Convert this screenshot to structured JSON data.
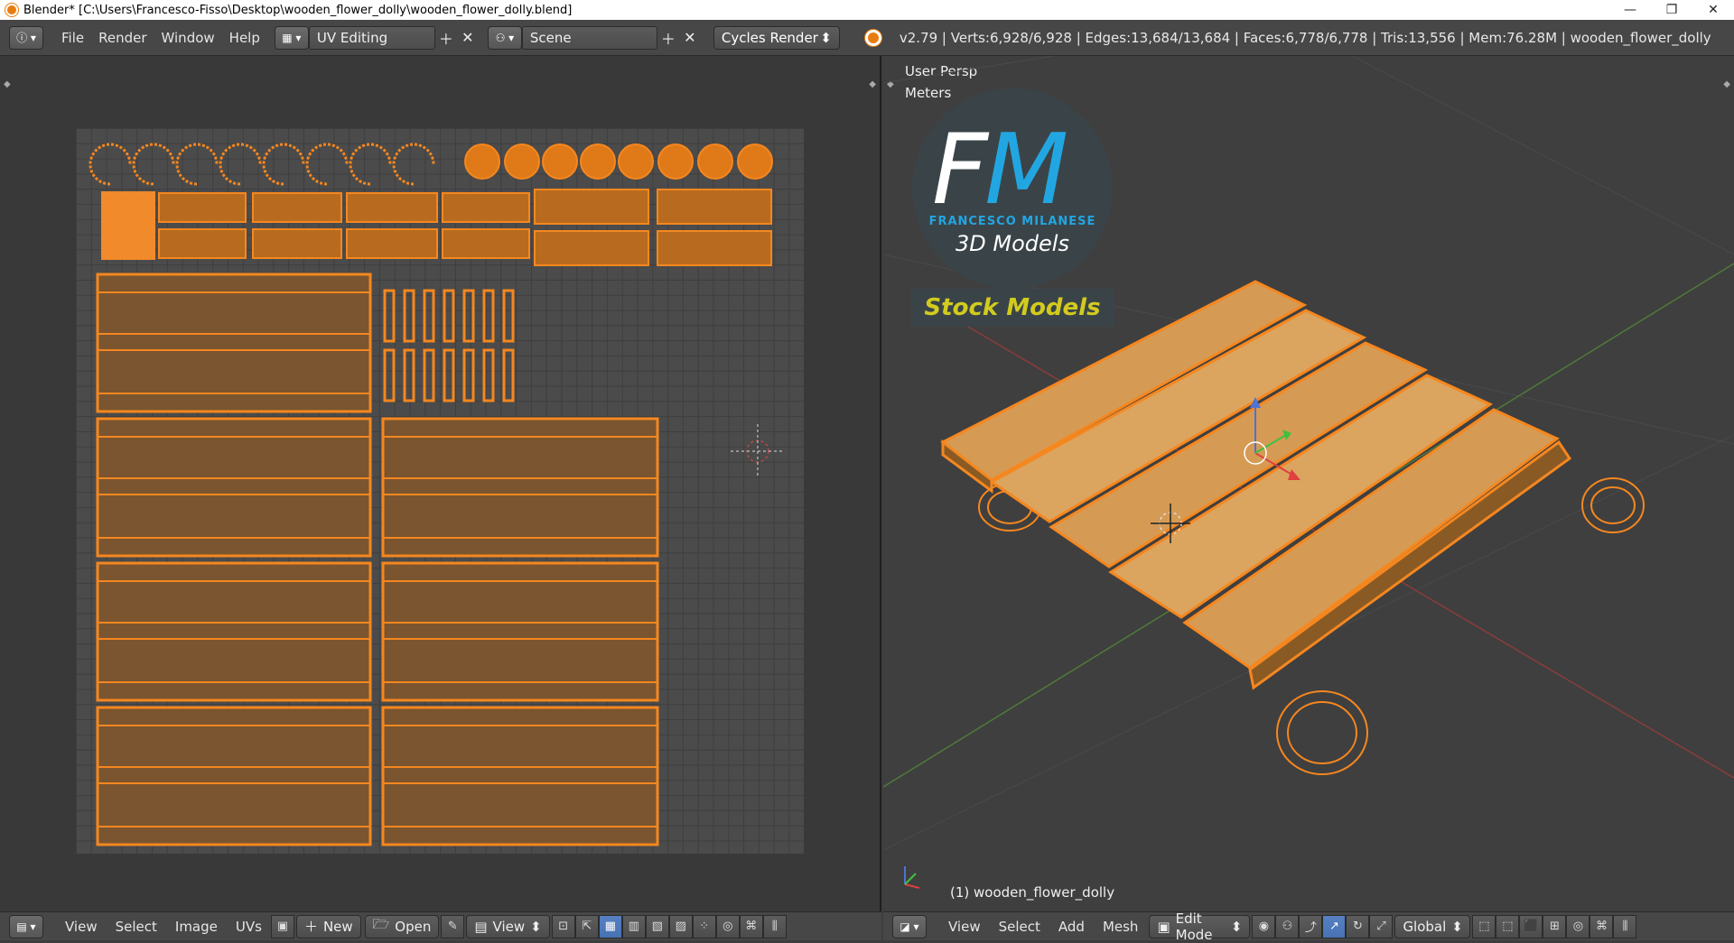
{
  "window": {
    "title": "Blender* [C:\\Users\\Francesco-Fisso\\Desktop\\wooden_flower_dolly\\wooden_flower_dolly.blend]",
    "minimize": "—",
    "maximize": "❐",
    "close": "✕"
  },
  "info_header": {
    "menus": [
      "File",
      "Render",
      "Window",
      "Help"
    ],
    "screen_layout": "UV Editing",
    "scene": "Scene",
    "render_engine": "Cycles Render",
    "stats": "v2.79 | Verts:6,928/6,928 | Edges:13,684/13,684 | Faces:6,778/6,778 | Tris:13,556 | Mem:76.28M | wooden_flower_dolly"
  },
  "viewport": {
    "view_label": "User Persp",
    "units_label": "Meters",
    "object_label": "(1) wooden_flower_dolly",
    "logo": {
      "initial_f": "F",
      "initial_m": "M",
      "name": "FRANCESCO MILANESE",
      "subtitle": "3D Models",
      "banner": "Stock Models"
    }
  },
  "uv_footer": {
    "menus": [
      "View",
      "Select",
      "Image",
      "UVs"
    ],
    "new_label": "New",
    "open_label": "Open",
    "view_label": "View"
  },
  "viewport_footer": {
    "menus": [
      "View",
      "Select",
      "Add",
      "Mesh"
    ],
    "mode": "Edit Mode",
    "orientation": "Global"
  },
  "colors": {
    "wire_orange": "#f5871f",
    "wood_light": "#d9a25a",
    "wood_dark": "#8a5a24",
    "accent_blue": "#22a6e2",
    "banner_yellow": "#d2cb1e"
  }
}
